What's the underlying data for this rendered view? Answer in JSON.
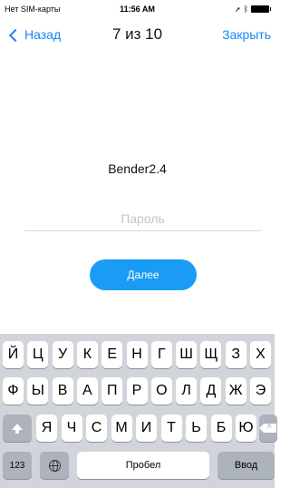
{
  "status_bar": {
    "carrier": "Нет SIM-карты",
    "time": "11:56 AM"
  },
  "nav": {
    "back_label": "Назад",
    "title": "7 из 10",
    "close_label": "Закрыть"
  },
  "login": {
    "username": "Bender2.4",
    "password_placeholder": "Пароль",
    "next_label": "Далее"
  },
  "keyboard": {
    "row1": [
      "Й",
      "Ц",
      "У",
      "К",
      "Е",
      "Н",
      "Г",
      "Ш",
      "Щ",
      "З",
      "Х"
    ],
    "row2": [
      "Ф",
      "Ы",
      "В",
      "А",
      "П",
      "Р",
      "О",
      "Л",
      "Д",
      "Ж",
      "Э"
    ],
    "row3": [
      "Я",
      "Ч",
      "С",
      "М",
      "И",
      "Т",
      "Ь",
      "Б",
      "Ю"
    ],
    "numbers_label": "123",
    "space_label": "Пробел",
    "enter_label": "Ввод"
  },
  "colors": {
    "accent": "#1a86f4",
    "button": "#1a9cf5",
    "keyboard_bg": "#d1d5db",
    "func_key": "#adb3bc"
  }
}
